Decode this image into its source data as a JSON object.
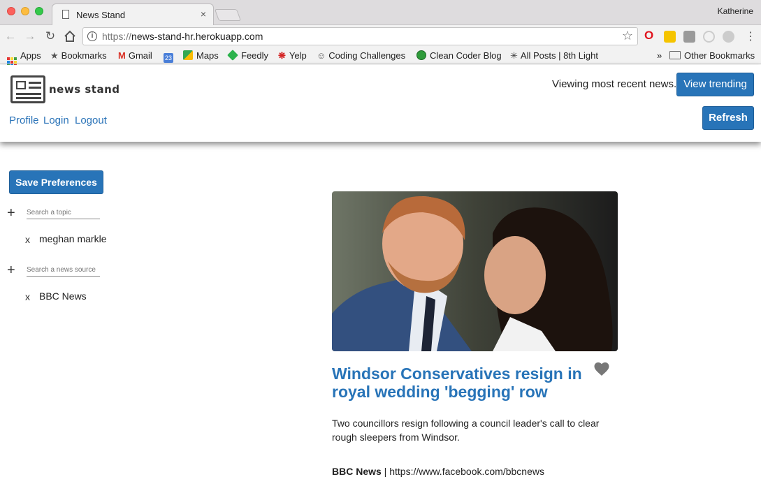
{
  "browser": {
    "tab_title": "News Stand",
    "tab_close": "×",
    "profile_name": "Katherine",
    "url_protocol": "https://",
    "url_host": "news-stand-hr.herokuapp.com",
    "bookmarks": [
      {
        "label": "Apps"
      },
      {
        "label": "Bookmarks"
      },
      {
        "label": "Gmail"
      },
      {
        "label": "23"
      },
      {
        "label": "Maps"
      },
      {
        "label": "Feedly"
      },
      {
        "label": "Yelp"
      },
      {
        "label": "Coding Challenges"
      },
      {
        "label": "Clean Coder Blog"
      },
      {
        "label": "All Posts | 8th Light"
      }
    ],
    "overflow": "»",
    "other_bookmarks": "Other Bookmarks"
  },
  "header": {
    "logo_text": "news stand",
    "nav": {
      "profile": "Profile",
      "login": "Login",
      "logout": "Logout"
    },
    "viewing_text": "Viewing most recent news.",
    "view_trending": "View trending",
    "refresh": "Refresh"
  },
  "sidebar": {
    "save_preferences": "Save Preferences",
    "topic_placeholder": "Search a topic",
    "source_placeholder": "Search a news source",
    "topics": [
      {
        "label": "meghan markle",
        "remove": "x"
      }
    ],
    "sources": [
      {
        "label": "BBC News",
        "remove": "x"
      }
    ],
    "add_symbol": "+"
  },
  "article": {
    "title": "Windsor Conservatives resign in royal wedding 'begging' row",
    "description": "Two councillors resign following a council leader's call to clear rough sleepers from Windsor.",
    "source": "BBC News",
    "separator": " | ",
    "source_url": "https://www.facebook.com/bbcnews"
  },
  "colors": {
    "accent": "#2874b8",
    "link": "#2a73b8",
    "heart": "#777777"
  }
}
